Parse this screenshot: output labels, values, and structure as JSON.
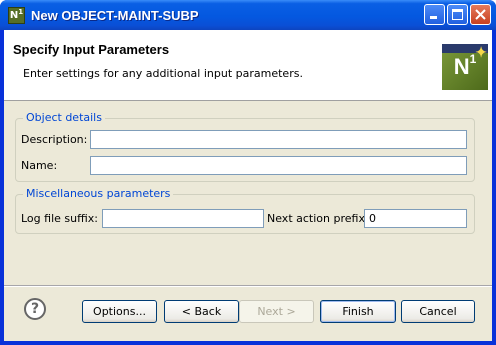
{
  "window": {
    "title": "New OBJECT-MAINT-SUBP",
    "icon_text": "N",
    "icon_sup": "1"
  },
  "header": {
    "title": "Specify Input Parameters",
    "description": "Enter settings for any additional input parameters.",
    "logo_text": "N",
    "logo_sup": "1"
  },
  "object_details": {
    "legend": "Object details",
    "description_label": "Description:",
    "description_value": "",
    "name_label": "Name:",
    "name_value": ""
  },
  "misc": {
    "legend": "Miscellaneous parameters",
    "log_suffix_label": "Log file suffix:",
    "log_suffix_value": "",
    "next_action_label": "Next action prefix:",
    "next_action_value": "0"
  },
  "buttons": {
    "help": "?",
    "options": "Options...",
    "back": "< Back",
    "next": "Next >",
    "finish": "Finish",
    "cancel": "Cancel"
  },
  "colors": {
    "titlebar": "#0458e0",
    "legend": "#0046d5",
    "dialog_bg": "#ece9d8"
  }
}
